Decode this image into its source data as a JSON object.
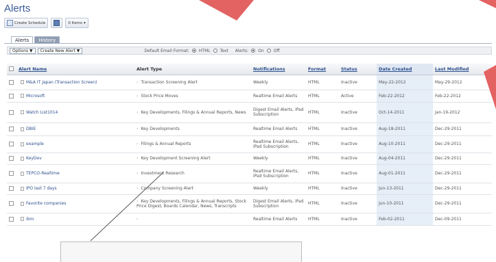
{
  "page": {
    "title": "Alerts"
  },
  "toolbar_top": {
    "create_label": "Create Schedule",
    "save_label": "Save",
    "items_label": "0 Items"
  },
  "tabs": [
    {
      "label": "Alerts",
      "active": false
    },
    {
      "label": "History",
      "active": true
    }
  ],
  "actions": {
    "options_label": "Options ▼",
    "create_new_label": "Create New Alert ▼",
    "email_format_label": "Default Email Format:",
    "html_label": "HTML",
    "text_label": "Text",
    "alerts_label": "Alerts:",
    "on_label": "On",
    "off_label": "Off"
  },
  "table": {
    "headers": {
      "name": "Alert Name",
      "type": "Alert Type",
      "notifications": "Notifications",
      "format": "Format",
      "status": "Status",
      "date_created": "Date Created",
      "last_modified": "Last Modified"
    },
    "rows": [
      {
        "name": "M&A IT Japan (Transaction Screen)",
        "type": "Transaction Screening Alert",
        "notifications": "Weekly",
        "format": "HTML",
        "status": "Inactive",
        "date_created": "May-22-2012",
        "last_modified": "May-29-2012"
      },
      {
        "name": "Microsoft",
        "type": "Stock Price Moves",
        "notifications": "Realtime Email Alerts",
        "format": "HTML",
        "status": "Active",
        "date_created": "Feb-22-2012",
        "last_modified": "Feb-22-2012"
      },
      {
        "name": "Watch List1014",
        "type": "Key Developments, Filings & Annual Reports, News",
        "notifications": "Digest Email Alerts, iPad Subscription",
        "format": "HTML",
        "status": "Inactive",
        "date_created": "Oct-14-2011",
        "last_modified": "Jan-19-2012"
      },
      {
        "name": "DBIE",
        "type": "Key Developments",
        "notifications": "Realtime Email Alerts",
        "format": "HTML",
        "status": "Inactive",
        "date_created": "Aug-18-2011",
        "last_modified": "Dec-29-2011"
      },
      {
        "name": "example",
        "type": "Filings & Annual Reports",
        "notifications": "Realtime Email Alerts, iPad Subscription",
        "format": "HTML",
        "status": "Inactive",
        "date_created": "Aug-10-2011",
        "last_modified": "Dec-29-2011"
      },
      {
        "name": "KeyDev",
        "type": "Key Development Screening Alert",
        "notifications": "Weekly",
        "format": "HTML",
        "status": "Inactive",
        "date_created": "Aug-04-2011",
        "last_modified": "Dec-29-2011"
      },
      {
        "name": "TEPCO-Realtime",
        "type": "Investment Research",
        "notifications": "Realtime Email Alerts, iPad Subscription",
        "format": "HTML",
        "status": "Inactive",
        "date_created": "Aug-01-2011",
        "last_modified": "Dec-29-2011"
      },
      {
        "name": "IPO last 7 days",
        "type": "Company Screening Alert",
        "notifications": "Weekly",
        "format": "HTML",
        "status": "Inactive",
        "date_created": "Jun-13-2011",
        "last_modified": "Dec-29-2011"
      },
      {
        "name": "Favorite companies",
        "type": "Key Developments, Filings & Annual Reports, Stock Price Digest, Boards Calendar, News, Transcripts",
        "notifications": "Digest Email Alerts, iPad Subscription",
        "format": "HTML",
        "status": "Inactive",
        "date_created": "Jun-10-2011",
        "last_modified": "Dec-29-2011"
      },
      {
        "name": "ibm",
        "type": "",
        "notifications": "Realtime Email Alerts",
        "format": "HTML",
        "status": "Inactive",
        "date_created": "Feb-02-2011",
        "last_modified": "Dec-09-2011"
      }
    ]
  },
  "colors": {
    "accent": "#2c4f8c",
    "highlight": "#e6eef8",
    "annotation_red": "#e05a5a"
  }
}
